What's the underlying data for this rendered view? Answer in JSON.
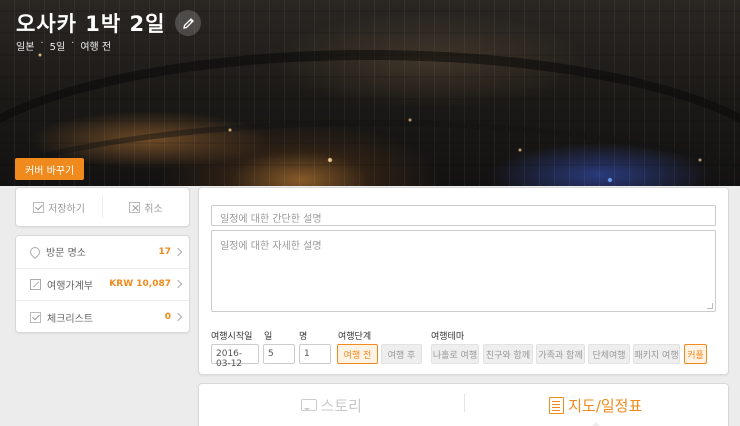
{
  "trip": {
    "title": "오사카 1박 2일",
    "meta": [
      "일본",
      "5일",
      "여행 전"
    ],
    "meta_sep": "·"
  },
  "cover": {
    "change_label": "커버 바꾸기"
  },
  "actions": {
    "save_label": "저장하기",
    "cancel_label": "취소"
  },
  "sidebar": {
    "items": [
      {
        "label": "방문 명소",
        "value": "17",
        "icon": "pin-icon"
      },
      {
        "label": "여행가계부",
        "value": "KRW 10,087",
        "icon": "budget-icon"
      },
      {
        "label": "체크리스트",
        "value": "0",
        "icon": "checklist-icon"
      }
    ]
  },
  "form": {
    "short_desc_placeholder": "일정에 대한 간단한 설명",
    "long_desc_placeholder": "일정에 대한 자세한 설명",
    "labels": {
      "start": "여행시작일",
      "days": "일",
      "people": "명",
      "stage": "여행단계",
      "theme": "여행테마"
    },
    "start_date": "2016-03-12",
    "days": "5",
    "people": "1",
    "stages": [
      {
        "label": "여행 전",
        "active": true
      },
      {
        "label": "여행 후",
        "active": false
      }
    ],
    "themes": [
      {
        "label": "나홀로 여행",
        "active": false
      },
      {
        "label": "친구와 함께",
        "active": false
      },
      {
        "label": "가족과 함께",
        "active": false
      },
      {
        "label": "단체여행",
        "active": false
      },
      {
        "label": "패키지 여행",
        "active": false
      },
      {
        "label": "커플",
        "active": true
      }
    ]
  },
  "tabs": [
    {
      "label": "스토리",
      "active": false,
      "icon": "speech-icon"
    },
    {
      "label": "지도/일정표",
      "active": true,
      "icon": "document-icon"
    }
  ],
  "colors": {
    "accent": "#f08a1c"
  }
}
